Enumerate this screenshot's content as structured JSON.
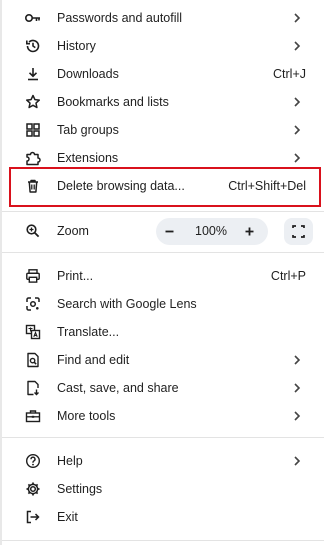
{
  "menu": {
    "passwords": {
      "label": "Passwords and autofill",
      "icon": "key-icon"
    },
    "history": {
      "label": "History",
      "icon": "history-icon"
    },
    "downloads": {
      "label": "Downloads",
      "shortcut": "Ctrl+J",
      "icon": "download-icon"
    },
    "bookmarks": {
      "label": "Bookmarks and lists",
      "icon": "star-icon"
    },
    "tab_groups": {
      "label": "Tab groups",
      "icon": "tab-groups-icon"
    },
    "extensions": {
      "label": "Extensions",
      "icon": "puzzle-icon"
    },
    "delete_data": {
      "label": "Delete browsing data...",
      "shortcut": "Ctrl+Shift+Del",
      "icon": "trash-icon"
    },
    "zoom": {
      "label": "Zoom",
      "value": "100%",
      "icon": "zoom-icon"
    },
    "print": {
      "label": "Print...",
      "shortcut": "Ctrl+P",
      "icon": "printer-icon"
    },
    "lens": {
      "label": "Search with Google Lens",
      "icon": "lens-icon"
    },
    "translate": {
      "label": "Translate...",
      "icon": "translate-icon"
    },
    "find_edit": {
      "label": "Find and edit",
      "icon": "find-page-icon"
    },
    "cast": {
      "label": "Cast, save, and share",
      "icon": "cast-save-icon"
    },
    "more_tools": {
      "label": "More tools",
      "icon": "toolbox-icon"
    },
    "help": {
      "label": "Help",
      "icon": "help-icon"
    },
    "settings": {
      "label": "Settings",
      "icon": "gear-icon"
    },
    "exit": {
      "label": "Exit",
      "icon": "exit-icon"
    }
  },
  "colors": {
    "highlight_border": "#d9111c",
    "control_bg": "#eceff3",
    "text": "#1f1f1f",
    "divider": "#e3e3e3"
  }
}
